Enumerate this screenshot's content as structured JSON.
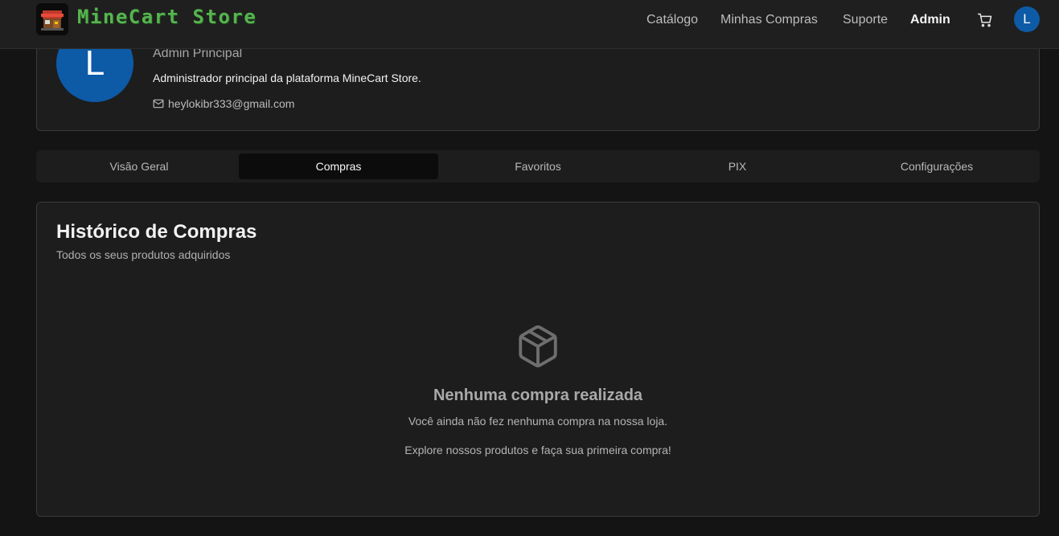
{
  "header": {
    "brand": "MineCart Store",
    "nav": [
      "Catálogo",
      "Minhas Compras",
      "Suporte",
      "Admin"
    ],
    "avatar_initial": "L",
    "icons": {
      "logo": "store-logo-icon",
      "cart": "cart-icon"
    }
  },
  "profile": {
    "avatar_initial": "L",
    "name": "Admin Principal",
    "description": "Administrador principal da plataforma MineCart Store.",
    "email": "heylokibr333@gmail.com",
    "email_icon": "mail-icon"
  },
  "tabs": [
    "Visão Geral",
    "Compras",
    "Favoritos",
    "PIX",
    "Configurações"
  ],
  "active_tab": "Compras",
  "purchases": {
    "title": "Histórico de Compras",
    "subtitle": "Todos os seus produtos adquiridos",
    "empty_icon": "package-icon",
    "empty_title": "Nenhuma compra realizada",
    "empty_text": "Você ainda não fez nenhuma compra na nossa loja.",
    "empty_cta": "Explore nossos produtos e faça sua primeira compra!"
  },
  "colors": {
    "brand_green": "#57b450",
    "avatar_blue": "#0d5aa7",
    "background": "#141414",
    "card": "#1d1d1d"
  }
}
